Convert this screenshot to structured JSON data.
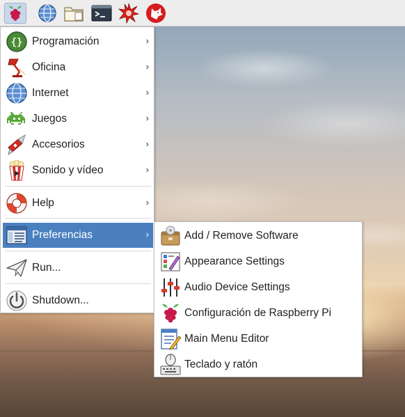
{
  "taskbar": {
    "launchers": [
      {
        "name": "raspberry-menu",
        "icon": "raspberry-icon"
      },
      {
        "name": "web-browser",
        "icon": "globe-icon"
      },
      {
        "name": "file-manager",
        "icon": "folder-icon"
      },
      {
        "name": "terminal",
        "icon": "terminal-icon"
      },
      {
        "name": "mathematica",
        "icon": "star-burst-icon"
      },
      {
        "name": "wolfram",
        "icon": "wolf-icon"
      }
    ]
  },
  "main_menu": {
    "items": [
      {
        "label": "Programación",
        "icon": "braces-icon",
        "has_submenu": true
      },
      {
        "label": "Oficina",
        "icon": "desk-lamp-icon",
        "has_submenu": true
      },
      {
        "label": "Internet",
        "icon": "globe-icon",
        "has_submenu": true
      },
      {
        "label": "Juegos",
        "icon": "space-invader-icon",
        "has_submenu": true
      },
      {
        "label": "Accesorios",
        "icon": "swiss-knife-icon",
        "has_submenu": true
      },
      {
        "label": "Sonido y vídeo",
        "icon": "popcorn-icon",
        "has_submenu": true
      },
      {
        "label": "Help",
        "icon": "lifebuoy-icon",
        "has_submenu": true
      },
      {
        "label": "Preferencias",
        "icon": "preferences-icon",
        "has_submenu": true,
        "selected": true
      },
      {
        "label": "Run...",
        "icon": "paper-plane-icon",
        "has_submenu": false
      },
      {
        "label": "Shutdown...",
        "icon": "power-icon",
        "has_submenu": false
      }
    ],
    "arrow_glyph": "›"
  },
  "submenu": {
    "parent": "Preferencias",
    "items": [
      {
        "label": "Add / Remove Software",
        "icon": "package-icon"
      },
      {
        "label": "Appearance Settings",
        "icon": "appearance-icon"
      },
      {
        "label": "Audio Device Settings",
        "icon": "sliders-icon"
      },
      {
        "label": "Configuración de Raspberry Pi",
        "icon": "raspberry-icon"
      },
      {
        "label": "Main Menu Editor",
        "icon": "menu-editor-icon"
      },
      {
        "label": "Teclado y ratón",
        "icon": "keyboard-mouse-icon"
      }
    ]
  },
  "colors": {
    "selection": "#4a80c0",
    "menu_bg": "#ffffff",
    "taskbar_bg": "#ededed"
  }
}
